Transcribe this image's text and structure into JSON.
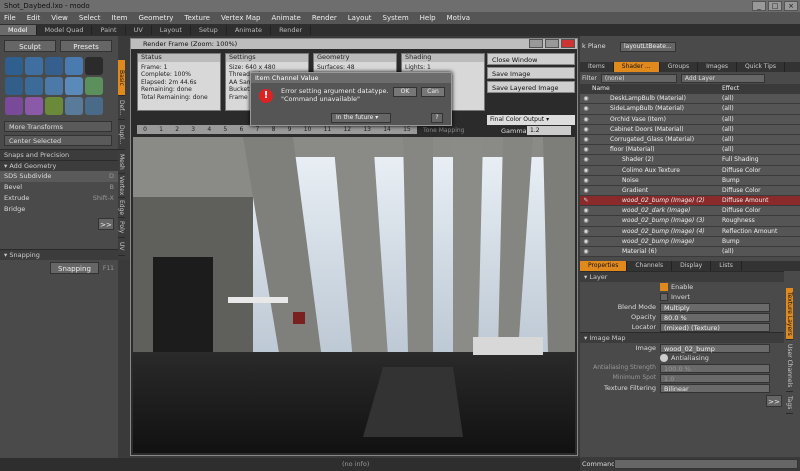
{
  "window": {
    "title": "Shot_Daybed.lxo - modo"
  },
  "menu": [
    "File",
    "Edit",
    "View",
    "Select",
    "Item",
    "Geometry",
    "Texture",
    "Vertex Map",
    "Animate",
    "Render",
    "Layout",
    "System",
    "Help",
    "Motiva"
  ],
  "layout_tabs": [
    "Model",
    "Model Quad",
    "Paint",
    "UV",
    "Layout",
    "Setup",
    "Animate",
    "Render"
  ],
  "left": {
    "sculpt": "Sculpt",
    "presets": "Presets",
    "more_transforms": "More Transforms",
    "center_selected": "Center Selected",
    "snaps": "Snaps and Precision",
    "add_geometry": "Add Geometry",
    "tools": [
      {
        "label": "SDS Subdivide",
        "key": "D"
      },
      {
        "label": "Bevel",
        "key": "B"
      },
      {
        "label": "Extrude",
        "key": "Shift-X"
      },
      {
        "label": "Bridge",
        "key": ""
      }
    ],
    "more": ">>",
    "snapping_head": "Snapping",
    "snapping_btn": "Snapping",
    "snapping_key": "F11",
    "vtabs": [
      "Basic",
      "Def...",
      "Dupl...",
      "Mesh",
      "Vertex",
      "Edge",
      "Poly",
      "UV"
    ]
  },
  "render": {
    "title": "Render Frame (Zoom: 100%)",
    "status": {
      "head": "Status",
      "frame": "Frame: 1",
      "complete": "Complete: 100%",
      "elapsed": "Elapsed: 2m 44.6s",
      "remaining": "Remaining: done",
      "total": "Total Remaining: done"
    },
    "settings": {
      "head": "Settings",
      "size": "Size: 640 x 480",
      "threads": "Threads: 4",
      "aa": "AA Samples: 8",
      "bucket": "Bucket Size: 32",
      "frame": "Frame No: 1"
    },
    "geometry": {
      "head": "Geometry",
      "surfaces": "Surfaces: 48"
    },
    "shading": {
      "head": "Shading",
      "lights": "Lights: 1"
    },
    "buttons": [
      "Close Window",
      "Save Image",
      "Save Layered Image"
    ],
    "output": "Final Color Output",
    "gamma_label": "Gamma",
    "gamma": "1.2",
    "tone": "Tone Mapping",
    "ruler": [
      "0",
      "1",
      "2",
      "3",
      "4",
      "5",
      "6",
      "7",
      "8",
      "9",
      "10",
      "11",
      "12",
      "13",
      "14",
      "15"
    ]
  },
  "dialog": {
    "title": "Item Channel Value",
    "msg1": "Error setting argument datatype.",
    "msg2": "\"Command unavailable\"",
    "ok": "OK",
    "cancel": "Can",
    "future": "In the future",
    "help": "?"
  },
  "status_bar": "(no info)",
  "right": {
    "top_item": "k Plane",
    "top_combo": "layoutLtBeate...",
    "tabs": [
      "Items",
      "Shader ...",
      "Groups",
      "Images",
      "Quick Tips"
    ],
    "filter_label": "Filter",
    "filter_val": "(none)",
    "add_layer": "Add Layer",
    "col_name": "Name",
    "col_effect": "Effect",
    "rows": [
      {
        "name": "DeskLampBulb (Material)",
        "eff": "(all)"
      },
      {
        "name": "SideLampBulb (Material)",
        "eff": "(all)"
      },
      {
        "name": "Orchid Vase (Item)",
        "eff": "(all)"
      },
      {
        "name": "Cabinet Doors (Material)",
        "eff": "(all)"
      },
      {
        "name": "Corrugated_Glass (Material)",
        "eff": "(all)"
      },
      {
        "name": "floor (Material)",
        "eff": "(all)"
      },
      {
        "name": "Shader (2)",
        "eff": "Full Shading"
      },
      {
        "name": "Colimo Aux Texture",
        "eff": "Diffuse Color"
      },
      {
        "name": "Noise",
        "eff": "Bump"
      },
      {
        "name": "Gradient",
        "eff": "Diffuse Color"
      },
      {
        "name": "wood_02_bump (Image) (2)",
        "eff": "Diffuse Amount"
      },
      {
        "name": "wood_02_dark (Image)",
        "eff": "Diffuse Color"
      },
      {
        "name": "wood_02_bump (Image) (3)",
        "eff": "Roughness"
      },
      {
        "name": "wood_02_bump (Image) (4)",
        "eff": "Reflection Amount"
      },
      {
        "name": "wood_02_bump (Image)",
        "eff": "Bump"
      },
      {
        "name": "Material (6)",
        "eff": "(all)"
      }
    ],
    "prop_tabs": [
      "Properties",
      "Channels",
      "Display",
      "Lists"
    ],
    "layer_head": "Layer",
    "enable": "Enable",
    "invert": "Invert",
    "blend_label": "Blend Mode",
    "blend_val": "Multiply",
    "opacity_label": "Opacity",
    "opacity_val": "80.0 %",
    "locator_label": "Locator",
    "locator_val": "(mixed) (Texture)",
    "imagemap_head": "Image Map",
    "image_label": "Image",
    "image_val": "wood_02_bump",
    "antialias": "Antialiasing",
    "aa_strength_label": "Antialiasing Strength",
    "aa_strength_val": "100.0 %",
    "min_spot_label": "Minimum Spot",
    "min_spot_val": "1.0",
    "filter_label2": "Texture Filtering",
    "filter_val2": "Bilinear",
    "more": ">>",
    "side_tabs": [
      "Texture Layers",
      "User Channels",
      "Tags"
    ],
    "command_label": "Command"
  }
}
